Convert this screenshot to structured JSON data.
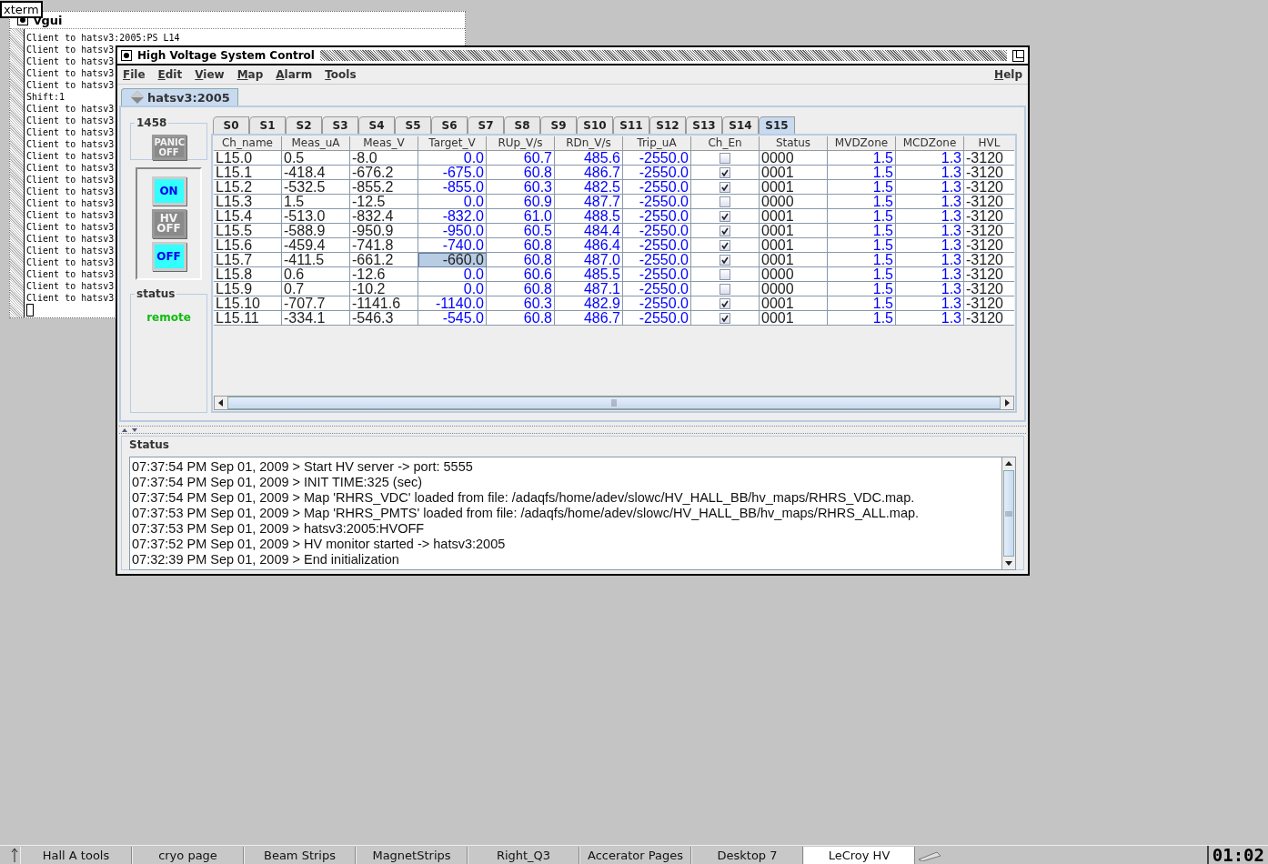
{
  "xterm_label": "xterm",
  "console_window": {
    "title": "vgui",
    "lines": [
      "Client to hatsv3:2005:PS L14",
      "Client to hatsv3",
      "Client to hatsv3",
      "Client to hatsv3",
      "Client to hatsv3",
      "Shift:1",
      "Client to hatsv3",
      "Client to hatsv3",
      "Client to hatsv3",
      "Client to hatsv3",
      "Client to hatsv3",
      "Client to hatsv3",
      "Client to hatsv3",
      "Client to hatsv3",
      "Client to hatsv3",
      "Client to hatsv3",
      "Client to hatsv3",
      "Client to hatsv3",
      "Client to hatsv3",
      "Client to hatsv3",
      "Client to hatsv3",
      "Client to hatsv3",
      "Client to hatsv3"
    ]
  },
  "window": {
    "title": "High Voltage System Control"
  },
  "menu": [
    "File",
    "Edit",
    "View",
    "Map",
    "Alarm",
    "Tools"
  ],
  "help_menu": "Help",
  "host_tab": {
    "label": "hatsv3:2005",
    "selected": true
  },
  "crate_group": {
    "title": "1458",
    "panic_button": {
      "label": "PANIC OFF",
      "disabled": true
    }
  },
  "power_buttons": [
    {
      "label": "ON",
      "disabled": false
    },
    {
      "label": "HV OFF",
      "disabled": true
    },
    {
      "label": "OFF",
      "disabled": false
    }
  ],
  "status_group": {
    "title": "status",
    "value": "remote"
  },
  "slot_tabs": [
    {
      "label": "S0",
      "selected": false
    },
    {
      "label": "S1",
      "selected": false
    },
    {
      "label": "S2",
      "selected": false
    },
    {
      "label": "S3",
      "selected": false
    },
    {
      "label": "S4",
      "selected": false
    },
    {
      "label": "S5",
      "selected": false
    },
    {
      "label": "S6",
      "selected": false
    },
    {
      "label": "S7",
      "selected": false
    },
    {
      "label": "S8",
      "selected": false
    },
    {
      "label": "S9",
      "selected": false
    },
    {
      "label": "S10",
      "selected": false
    },
    {
      "label": "S11",
      "selected": false
    },
    {
      "label": "S12",
      "selected": false
    },
    {
      "label": "S13",
      "selected": false
    },
    {
      "label": "S14",
      "selected": false
    },
    {
      "label": "S15",
      "selected": true
    }
  ],
  "table": {
    "columns": [
      {
        "label": "Ch_name",
        "kind": "text"
      },
      {
        "label": "Meas_uA",
        "kind": "text"
      },
      {
        "label": "Meas_V",
        "kind": "text"
      },
      {
        "label": "Target_V",
        "kind": "value"
      },
      {
        "label": "RUp_V/s",
        "kind": "value"
      },
      {
        "label": "RDn_V/s",
        "kind": "value"
      },
      {
        "label": "Trip_uA",
        "kind": "value"
      },
      {
        "label": "Ch_En",
        "kind": "check"
      },
      {
        "label": "Status",
        "kind": "text"
      },
      {
        "label": "MVDZone",
        "kind": "value"
      },
      {
        "label": "MCDZone",
        "kind": "value"
      },
      {
        "label": "HVL",
        "kind": "text"
      }
    ],
    "rows": [
      {
        "cells": [
          "L15.0",
          "0.5",
          "-8.0",
          "0.0",
          "60.7",
          "485.6",
          "-2550.0",
          false,
          "0000",
          "1.5",
          "1.3",
          "-3120"
        ],
        "target_selected": false
      },
      {
        "cells": [
          "L15.1",
          "-418.4",
          "-676.2",
          "-675.0",
          "60.8",
          "486.7",
          "-2550.0",
          true,
          "0001",
          "1.5",
          "1.3",
          "-3120"
        ],
        "target_selected": false
      },
      {
        "cells": [
          "L15.2",
          "-532.5",
          "-855.2",
          "-855.0",
          "60.3",
          "482.5",
          "-2550.0",
          true,
          "0001",
          "1.5",
          "1.3",
          "-3120"
        ],
        "target_selected": false
      },
      {
        "cells": [
          "L15.3",
          "1.5",
          "-12.5",
          "0.0",
          "60.9",
          "487.7",
          "-2550.0",
          false,
          "0000",
          "1.5",
          "1.3",
          "-3120"
        ],
        "target_selected": false
      },
      {
        "cells": [
          "L15.4",
          "-513.0",
          "-832.4",
          "-832.0",
          "61.0",
          "488.5",
          "-2550.0",
          true,
          "0001",
          "1.5",
          "1.3",
          "-3120"
        ],
        "target_selected": false
      },
      {
        "cells": [
          "L15.5",
          "-588.9",
          "-950.9",
          "-950.0",
          "60.5",
          "484.4",
          "-2550.0",
          true,
          "0001",
          "1.5",
          "1.3",
          "-3120"
        ],
        "target_selected": false
      },
      {
        "cells": [
          "L15.6",
          "-459.4",
          "-741.8",
          "-740.0",
          "60.8",
          "486.4",
          "-2550.0",
          true,
          "0001",
          "1.5",
          "1.3",
          "-3120"
        ],
        "target_selected": false
      },
      {
        "cells": [
          "L15.7",
          "-411.5",
          "-661.2",
          "-660.0",
          "60.8",
          "487.0",
          "-2550.0",
          true,
          "0001",
          "1.5",
          "1.3",
          "-3120"
        ],
        "target_selected": true
      },
      {
        "cells": [
          "L15.8",
          "0.6",
          "-12.6",
          "0.0",
          "60.6",
          "485.5",
          "-2550.0",
          false,
          "0000",
          "1.5",
          "1.3",
          "-3120"
        ],
        "target_selected": false
      },
      {
        "cells": [
          "L15.9",
          "0.7",
          "-10.2",
          "0.0",
          "60.8",
          "487.1",
          "-2550.0",
          false,
          "0000",
          "1.5",
          "1.3",
          "-3120"
        ],
        "target_selected": false
      },
      {
        "cells": [
          "L15.10",
          "-707.7",
          "-1141.6",
          "-1140.0",
          "60.3",
          "482.9",
          "-2550.0",
          true,
          "0001",
          "1.5",
          "1.3",
          "-3120"
        ],
        "target_selected": false
      },
      {
        "cells": [
          "L15.11",
          "-334.1",
          "-546.3",
          "-545.0",
          "60.8",
          "486.7",
          "-2550.0",
          true,
          "0001",
          "1.5",
          "1.3",
          "-3120"
        ],
        "target_selected": false
      }
    ]
  },
  "status_log": {
    "title": "Status",
    "lines": [
      "07:37:54 PM Sep 01, 2009 > Start HV server -> port: 5555",
      "07:37:54 PM Sep 01, 2009 > INIT TIME:325 (sec)",
      "07:37:54 PM Sep 01, 2009 > Map 'RHRS_VDC' loaded from file: /adaqfs/home/adev/slowc/HV_HALL_BB/hv_maps/RHRS_VDC.map.",
      "07:37:53 PM Sep 01, 2009 > Map 'RHRS_PMTS' loaded from file: /adaqfs/home/adev/slowc/HV_HALL_BB/hv_maps/RHRS_ALL.map.",
      "07:37:53 PM Sep 01, 2009 > hatsv3:2005:HVOFF",
      "07:37:52 PM Sep 01, 2009 > HV monitor started -> hatsv3:2005",
      "07:32:39 PM Sep 01, 2009 > End initialization"
    ]
  },
  "taskbar": {
    "items": [
      {
        "label": "Hall A tools",
        "selected": false
      },
      {
        "label": "cryo page",
        "selected": false
      },
      {
        "label": "Beam Strips",
        "selected": false
      },
      {
        "label": "MagnetStrips",
        "selected": false
      },
      {
        "label": "Right_Q3",
        "selected": false
      },
      {
        "label": "Accerator Pages",
        "selected": false
      },
      {
        "label": "Desktop 7",
        "selected": false
      },
      {
        "label": "LeCroy HV",
        "selected": true
      }
    ],
    "clock": "01:02"
  }
}
